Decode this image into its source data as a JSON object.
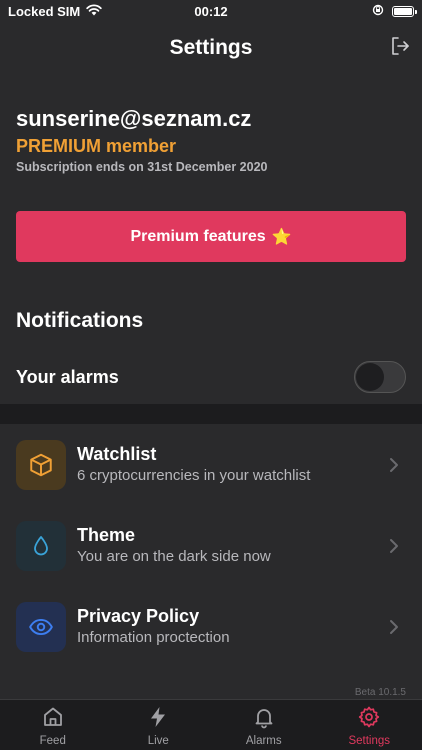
{
  "status_bar": {
    "carrier": "Locked SIM",
    "time": "00:12"
  },
  "header": {
    "title": "Settings"
  },
  "account": {
    "email": "sunserine@seznam.cz",
    "plan": "PREMIUM member",
    "subscription": "Subscription ends on 31st December 2020"
  },
  "premium_button": {
    "label": "Premium features",
    "emoji": "⭐"
  },
  "notifications": {
    "title": "Notifications",
    "alarms_label": "Your alarms",
    "alarms_enabled": false
  },
  "list": [
    {
      "title": "Watchlist",
      "subtitle": "6 cryptocurrencies in your watchlist",
      "icon": "cube-icon",
      "icon_bg": "#4a3a1f",
      "icon_color": "#f0a035"
    },
    {
      "title": "Theme",
      "subtitle": "You are on the dark side now",
      "icon": "droplet-icon",
      "icon_bg": "#223038",
      "icon_color": "#3aa3d8"
    },
    {
      "title": "Privacy Policy",
      "subtitle": "Information proctection",
      "icon": "eye-icon",
      "icon_bg": "#233052",
      "icon_color": "#3d7ef0"
    }
  ],
  "version": "Beta 10.1.5",
  "tabs": [
    {
      "label": "Feed",
      "icon": "home-icon",
      "active": false
    },
    {
      "label": "Live",
      "icon": "lightning-icon",
      "active": false
    },
    {
      "label": "Alarms",
      "icon": "bell-icon",
      "active": false
    },
    {
      "label": "Settings",
      "icon": "gear-icon",
      "active": true
    }
  ],
  "colors": {
    "accent": "#e0395e",
    "premium": "#f0a035",
    "background": "#2a2a2c"
  }
}
